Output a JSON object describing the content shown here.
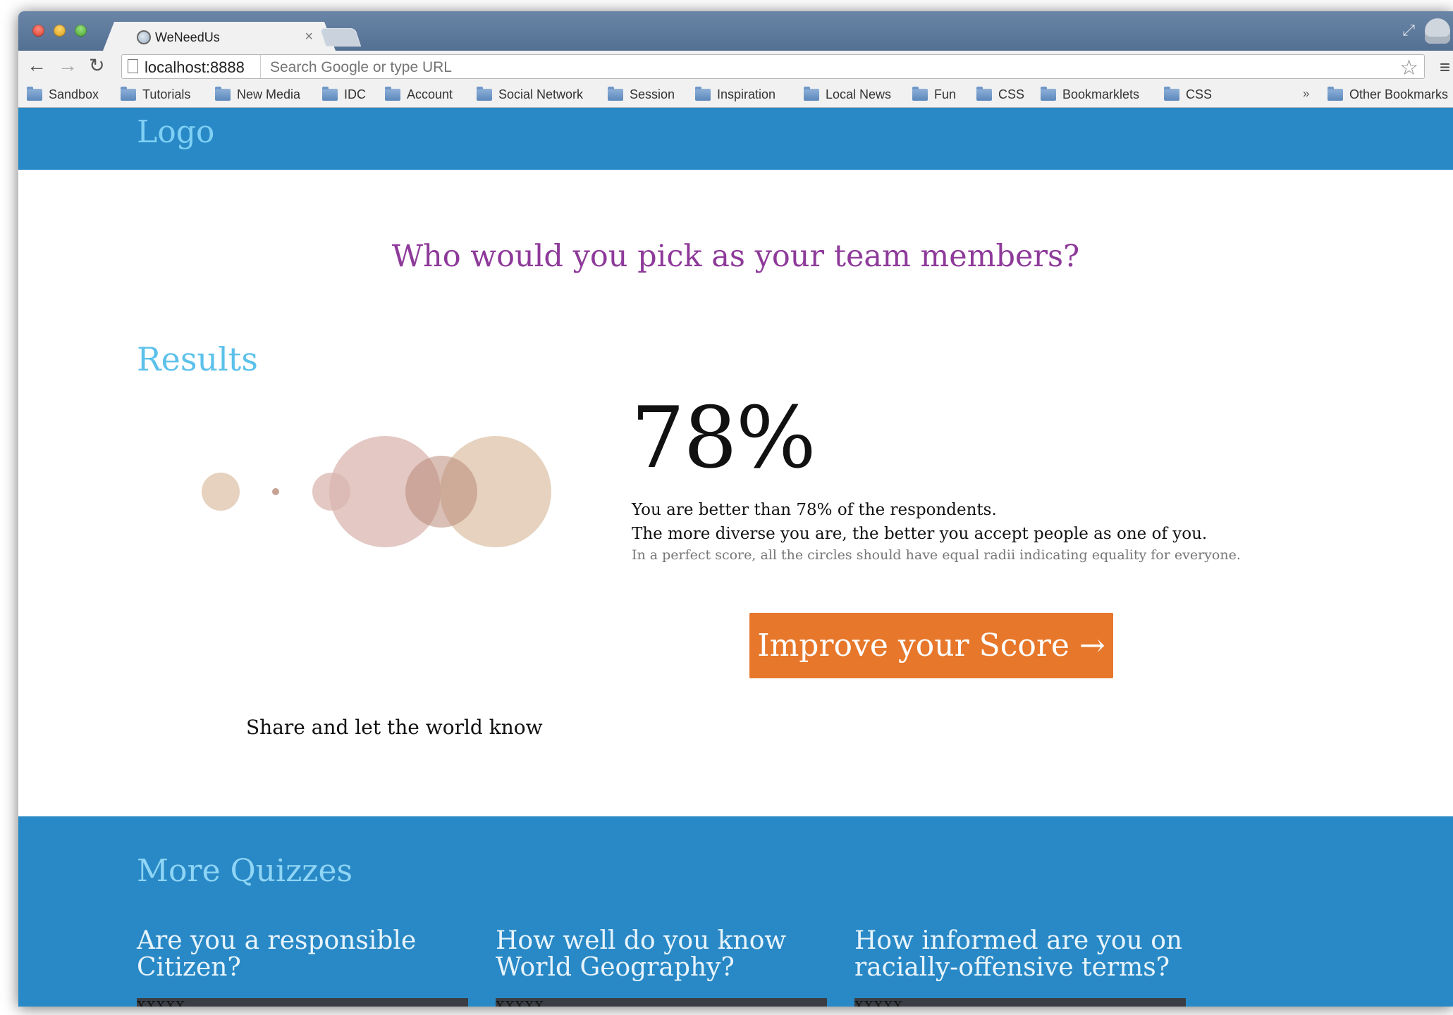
{
  "browser": {
    "tab_title": "WeNeedUs",
    "tab_close": "×",
    "url_host": "localhost:8888",
    "omnibox_placeholder": "Search Google or type URL",
    "bookmarks": [
      "Sandbox",
      "Tutorials",
      "New Media",
      "IDC",
      "Account",
      "Social Network",
      "Session",
      "Inspiration",
      "Local News",
      "Fun",
      "CSS",
      "Bookmarklets",
      "CSS"
    ],
    "bookmarks_overflow": "»",
    "other_bookmarks": "Other Bookmarks",
    "icons": [
      "back-arrow-icon",
      "forward-arrow-icon",
      "reload-icon",
      "page-icon",
      "star-icon",
      "menu-icon",
      "folder-icon",
      "globe-favicon",
      "fullscreen-icon",
      "incognito-icon"
    ]
  },
  "header": {
    "logo": "Logo"
  },
  "main": {
    "question": "Who would you pick as your team members?",
    "results_title": "Results",
    "score": "78%",
    "score_line1": "You are better than 78% of the respondents.",
    "score_line2": "The more diverse you are, the better you accept people as one of you.",
    "score_note": "In a perfect score, all the circles should have equal radii indicating equality for everyone.",
    "improve_button": "Improve your Score →",
    "share_text": "Share and let the world know"
  },
  "footer": {
    "more_title": "More Quizzes",
    "quizzes": [
      {
        "title_line1": "Are you a responsible",
        "title_line2": "Citizen?",
        "tag": "XXXXX"
      },
      {
        "title_line1": "How well do you know",
        "title_line2": "World Geography?",
        "tag": "XXXXX"
      },
      {
        "title_line1": "How informed are you on",
        "title_line2": "racially-offensive terms?",
        "tag": "XXXXX"
      }
    ]
  },
  "colors": {
    "header_blue": "#2989c6",
    "logo_light_blue": "#7fd0f5",
    "question_purple": "#8e3a9a",
    "results_blue": "#5cc1ea",
    "button_orange": "#e7772a",
    "circle_pink": "#d9b5b0",
    "circle_tan": "#dec3a8",
    "circle_brown": "#b98a78"
  }
}
